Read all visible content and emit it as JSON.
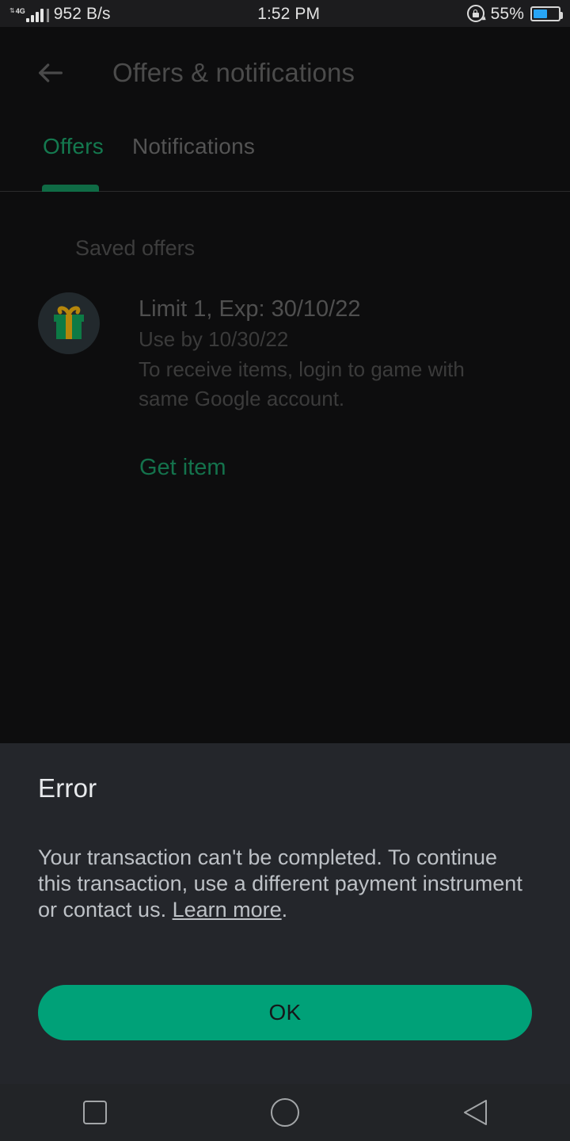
{
  "status_bar": {
    "network_type": "4G",
    "data_rate": "952 B/s",
    "time": "1:52 PM",
    "battery_percent": "55%",
    "battery_level": 55,
    "rotation_lock_icon": "rotation-lock-icon",
    "signal_icon": "signal-bars-icon",
    "battery_icon": "battery-icon",
    "battery_color": "#28a5f5"
  },
  "app_bar": {
    "back_icon": "back-arrow-icon",
    "title": "Offers & notifications"
  },
  "tabs": [
    {
      "label": "Offers",
      "active": true
    },
    {
      "label": "Notifications",
      "active": false
    }
  ],
  "content": {
    "section_label": "Saved offers",
    "offer": {
      "icon": "gift-icon",
      "icon_box_color": "#0d7a45",
      "icon_ribbon_color": "#b5860b",
      "title": "Limit 1, Exp: 30/10/22",
      "use_by": "Use by 10/30/22",
      "description": "To receive items, login to game with same Google account.",
      "action_label": "Get item",
      "action_color": "#14724c"
    }
  },
  "dialog": {
    "title": "Error",
    "message_before_link": "Your transaction can't be completed. To continue this transaction, use a different payment instrument or contact us. ",
    "link_label": "Learn more",
    "message_after_link": ".",
    "ok_label": "OK",
    "ok_color": "#00a178"
  },
  "nav_bar": {
    "recents_icon": "square-recents-icon",
    "home_icon": "circle-home-icon",
    "back_icon": "triangle-back-icon"
  }
}
